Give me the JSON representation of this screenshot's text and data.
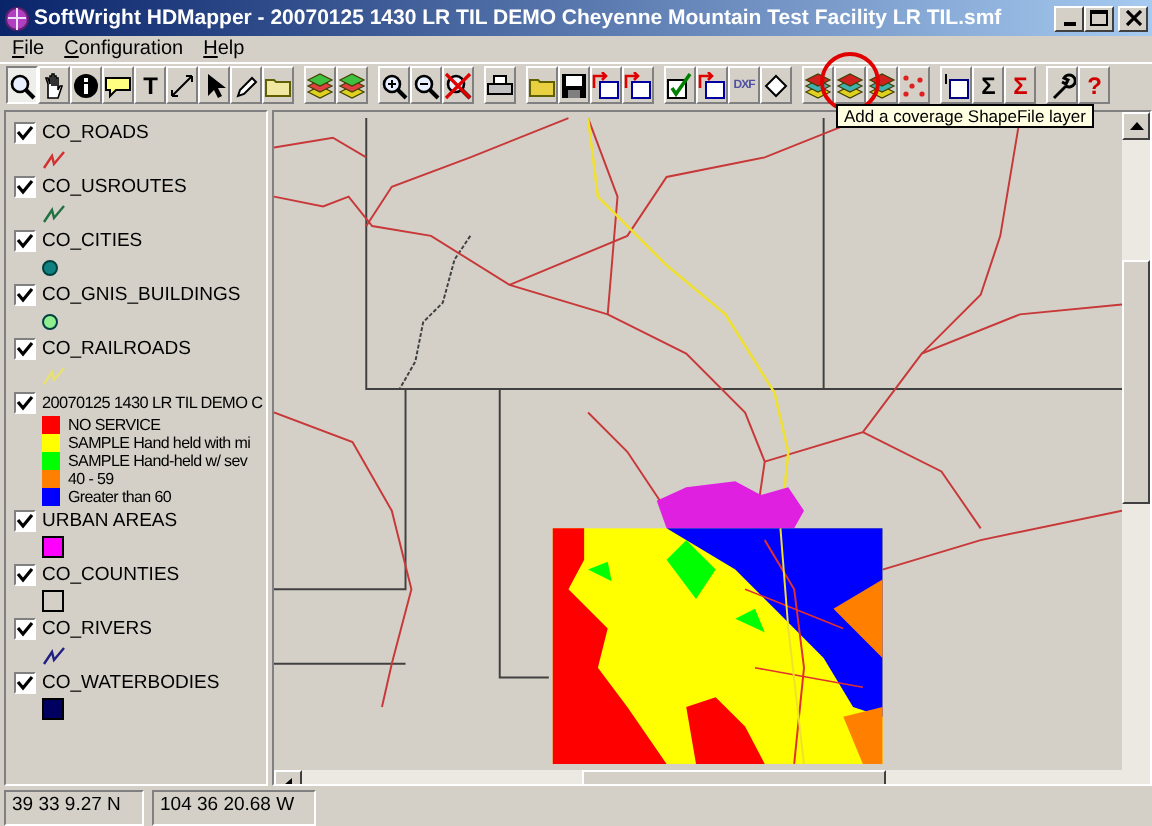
{
  "window": {
    "title": "SoftWright HDMapper - 20070125 1430 LR TIL DEMO Cheyenne Mountain Test Facility LR TIL.smf"
  },
  "menu": [
    {
      "label": "File"
    },
    {
      "label": "Configuration"
    },
    {
      "label": "Help"
    }
  ],
  "toolbar": [
    [
      {
        "kind": "magnifier",
        "pressed": true
      },
      {
        "kind": "hand",
        "pressed": false
      },
      {
        "kind": "info",
        "pressed": false
      },
      {
        "kind": "note",
        "pressed": false
      },
      {
        "kind": "text",
        "label": "T",
        "pressed": false
      },
      {
        "kind": "line",
        "pressed": false
      },
      {
        "kind": "pointer",
        "pressed": false
      },
      {
        "kind": "pen",
        "pressed": false
      },
      {
        "kind": "folder",
        "pressed": false
      }
    ],
    [
      {
        "kind": "layers",
        "pressed": false
      },
      {
        "kind": "layers",
        "pressed": false
      }
    ],
    [
      {
        "kind": "zoom-in",
        "pressed": false
      },
      {
        "kind": "zoom-out",
        "pressed": false
      },
      {
        "kind": "zoom-cancel",
        "pressed": false
      }
    ],
    [
      {
        "kind": "printer",
        "pressed": false
      }
    ],
    [
      {
        "kind": "open",
        "pressed": false
      },
      {
        "kind": "save",
        "pressed": false
      },
      {
        "kind": "export",
        "pressed": false
      },
      {
        "kind": "export",
        "pressed": false
      }
    ],
    [
      {
        "kind": "check",
        "pressed": false
      },
      {
        "kind": "import",
        "pressed": false
      },
      {
        "kind": "text",
        "label": "DXF",
        "pressed": false
      },
      {
        "kind": "diamond",
        "pressed": false
      }
    ],
    [
      {
        "kind": "add-layer",
        "pressed": false
      },
      {
        "kind": "add-layer",
        "pressed": false,
        "circled": true
      },
      {
        "kind": "add-layer",
        "pressed": false
      },
      {
        "kind": "dots",
        "pressed": false
      }
    ],
    [
      {
        "kind": "frame",
        "pressed": false
      },
      {
        "kind": "text",
        "label": "Σ",
        "pressed": false
      },
      {
        "kind": "text",
        "label": "Σ",
        "pressed": false
      }
    ],
    [
      {
        "kind": "wrench",
        "pressed": false
      },
      {
        "kind": "text",
        "label": "?",
        "pressed": false
      }
    ]
  ],
  "tooltip": "Add a coverage ShapeFile layer",
  "layers": [
    {
      "name": "CO_ROADS",
      "checked": true,
      "kind": "line",
      "color": "#d03030"
    },
    {
      "name": "CO_USROUTES",
      "checked": true,
      "kind": "line",
      "color": "#207040"
    },
    {
      "name": "CO_CITIES",
      "checked": true,
      "kind": "dot",
      "color": "#108080"
    },
    {
      "name": "CO_GNIS_BUILDINGS",
      "checked": true,
      "kind": "dot",
      "color": "#90ee90"
    },
    {
      "name": "CO_RAILROADS",
      "checked": true,
      "kind": "line",
      "color": "#e8e070"
    },
    {
      "name": "20070125 1430 LR TIL DEMO C",
      "checked": true,
      "kind": "classes",
      "classes": [
        {
          "label": "NO SERVICE",
          "color": "#ff0000"
        },
        {
          "label": "SAMPLE Hand held with mi",
          "color": "#ffff00"
        },
        {
          "label": "SAMPLE Hand-held w/ sev",
          "color": "#00ff00"
        },
        {
          "label": "40 - 59",
          "color": "#ff8000"
        },
        {
          "label": "Greater than 60",
          "color": "#0000ff"
        }
      ]
    },
    {
      "name": "URBAN AREAS",
      "checked": true,
      "kind": "square",
      "color": "#ff00ff"
    },
    {
      "name": "CO_COUNTIES",
      "checked": true,
      "kind": "square",
      "color": "#d4d0c8"
    },
    {
      "name": "CO_RIVERS",
      "checked": true,
      "kind": "line",
      "color": "#202080"
    },
    {
      "name": "CO_WATERBODIES",
      "checked": true,
      "kind": "square",
      "color": "#000060"
    }
  ],
  "status_bar": [
    "39 33 9.27 N",
    "104 36 20.68 W"
  ]
}
